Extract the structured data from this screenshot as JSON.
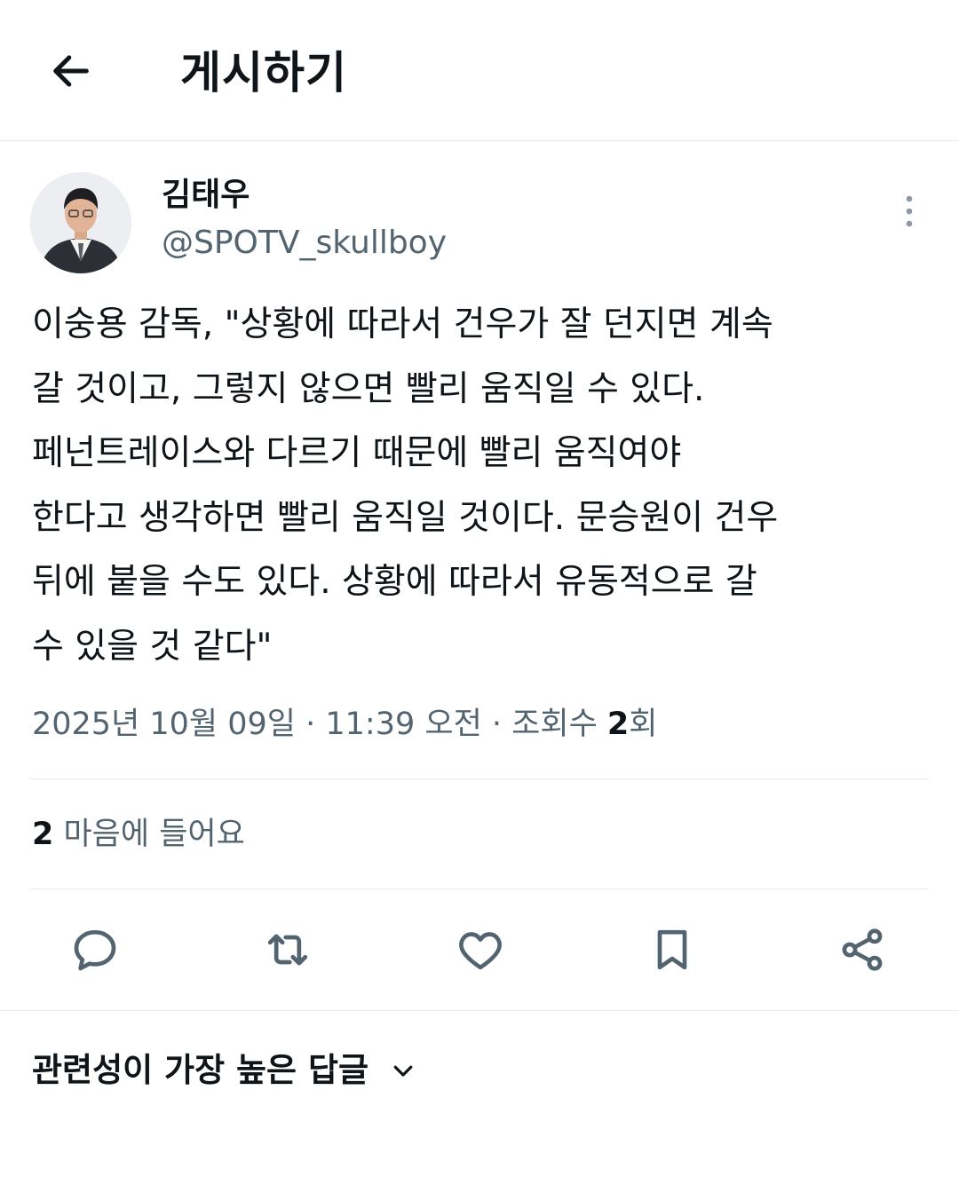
{
  "header": {
    "title": "게시하기",
    "back_icon": "arrow-left-icon"
  },
  "author": {
    "name": "김태우",
    "handle": "@SPOTV_skullboy",
    "avatar_icon": "profile-photo"
  },
  "tweet": {
    "text": "이숭용 감독, \"상황에 따라서 건우가 잘 던지면 계속\n갈 것이고, 그렇지 않으면 빨리 움직일 수 있다.\n페넌트레이스와 다르기 때문에 빨리 움직여야\n한다고 생각하면 빨리 움직일 것이다. 문승원이 건우\n뒤에 붙을 수도 있다. 상황에 따라서 유동적으로 갈\n수 있을 것 같다\""
  },
  "meta": {
    "date": "2025년 10월 09일",
    "separator": " · ",
    "time": "11:39 오전",
    "views_label": "조회수 ",
    "views_count": "2",
    "views_suffix": "회"
  },
  "engagement": {
    "likes_count": "2",
    "likes_label": " 마음에 들어요"
  },
  "actions": [
    {
      "name": "reply",
      "icon": "speech-bubble-icon"
    },
    {
      "name": "repost",
      "icon": "repost-icon"
    },
    {
      "name": "like",
      "icon": "heart-icon"
    },
    {
      "name": "bookmark",
      "icon": "bookmark-icon"
    },
    {
      "name": "share",
      "icon": "share-icon"
    }
  ],
  "replies_sort": {
    "label": "관련성이 가장 높은 답글",
    "icon": "chevron-down-icon"
  },
  "colors": {
    "text": "#0f1419",
    "secondary": "#536471",
    "divider": "#e5e8eb"
  }
}
